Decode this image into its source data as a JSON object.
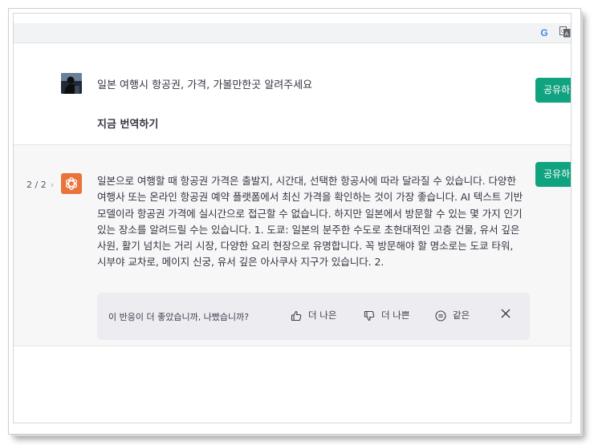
{
  "browser": {
    "google_icon_label": "G",
    "icons": [
      "google-icon",
      "translate-icon"
    ]
  },
  "conversation": {
    "user_message": "일본 여행시 항공권, 가격, 가볼만한곳 알려주세요",
    "user_followup": "지금 번역하기",
    "share_label": "공유하",
    "pager": "2 / 2",
    "assistant_message": "일본으로 여행할 때 항공권 가격은 출발지, 시간대, 선택한 항공사에 따라 달라질 수 있습니다. 다양한 여행사 또는 온라인 항공권 예약 플랫폼에서 최신 가격을 확인하는 것이 가장 좋습니다. AI 텍스트 기반 모델이라 항공권 가격에 실시간으로 접근할 수 없습니다. 하지만 일본에서 방문할 수 있는 몇 가지 인기 있는 장소를 알려드릴 수는 있습니다. 1. 도쿄: 일본의 분주한 수도로 초현대적인 고층 건물, 유서 깊은 사원, 활기 넘치는 거리 시장, 다양한 요리 현장으로 유명합니다. 꼭 방문해야 할 명소로는 도쿄 타워, 시부야 교차로, 메이지 신궁, 유서 깊은 아사쿠사 지구가 있습니다. 2."
  },
  "feedback": {
    "question": "이 반응이 더 좋았습니까, 나빴습니까?",
    "better": "더 나은",
    "worse": "더 나쁜",
    "same": "같은"
  },
  "colors": {
    "accent": "#10a37f",
    "assistant_bg": "#f7f7f8",
    "feedback_bg": "#ececf1",
    "logo_bg": "#e8743b",
    "text": "#343541"
  }
}
